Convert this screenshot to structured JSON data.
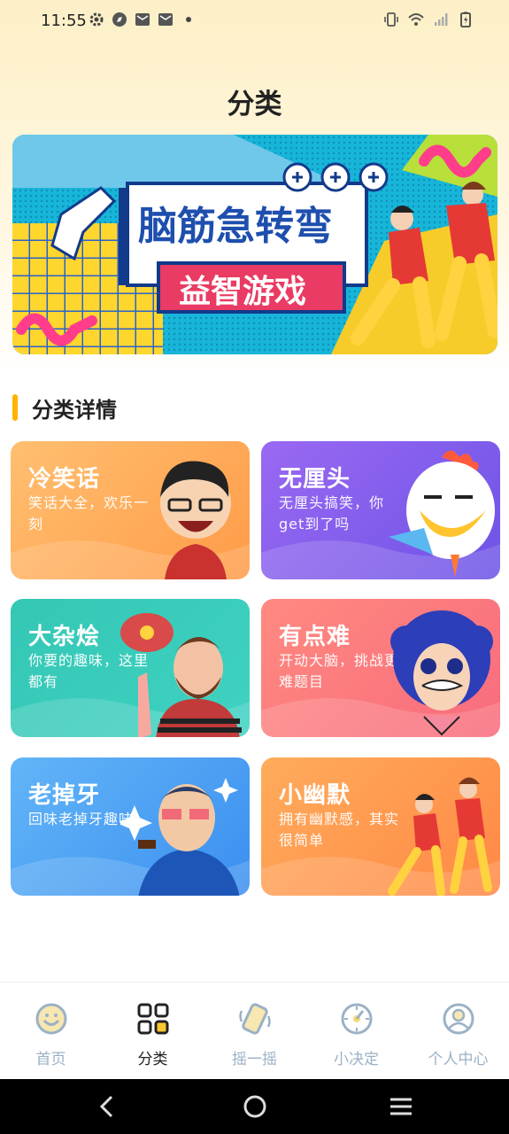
{
  "status_bar": {
    "time": "11:55"
  },
  "page": {
    "title": "分类"
  },
  "banner": {
    "title": "脑筋急转弯",
    "subtitle": "益智游戏"
  },
  "section": {
    "title": "分类详情"
  },
  "categories": [
    {
      "title": "冷笑话",
      "desc": "笑话大全，欢乐一刻"
    },
    {
      "title": "无厘头",
      "desc": "无厘头搞笑，你get到了吗"
    },
    {
      "title": "大杂烩",
      "desc": "你要的趣味，这里都有"
    },
    {
      "title": "有点难",
      "desc": "开动大脑，挑战更难题目"
    },
    {
      "title": "老掉牙",
      "desc": "回味老掉牙趣味"
    },
    {
      "title": "小幽默",
      "desc": "拥有幽默感，其实很简单"
    }
  ],
  "tabs": [
    {
      "label": "首页",
      "icon": "smile-icon"
    },
    {
      "label": "分类",
      "icon": "grid-icon"
    },
    {
      "label": "摇一摇",
      "icon": "shake-phone-icon"
    },
    {
      "label": "小决定",
      "icon": "spinner-icon"
    },
    {
      "label": "个人中心",
      "icon": "user-icon"
    }
  ],
  "colors": {
    "accent": "#ffb300",
    "tab_inactive": "#9bb1c6",
    "tab_active": "#222222"
  }
}
